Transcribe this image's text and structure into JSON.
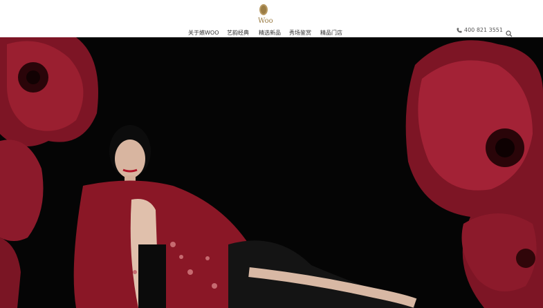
{
  "brand": {
    "logo_text": "Woo",
    "logo_icon": "woo-crest-logo"
  },
  "nav": {
    "items": [
      {
        "label": "关于嬿WOO"
      },
      {
        "label": "艺韵经典"
      },
      {
        "label": "精选新品"
      },
      {
        "label": "秀场鉴赏"
      },
      {
        "label": "精品门店"
      }
    ]
  },
  "contact": {
    "phone_icon": "phone-icon",
    "phone": "400 821 3551"
  },
  "search": {
    "icon": "search-icon"
  },
  "hero": {
    "description_icon": "campaign-banner-image",
    "colors": {
      "background": "#050505",
      "flower": "#8c1a2b",
      "shawl": "#8a1726"
    }
  }
}
